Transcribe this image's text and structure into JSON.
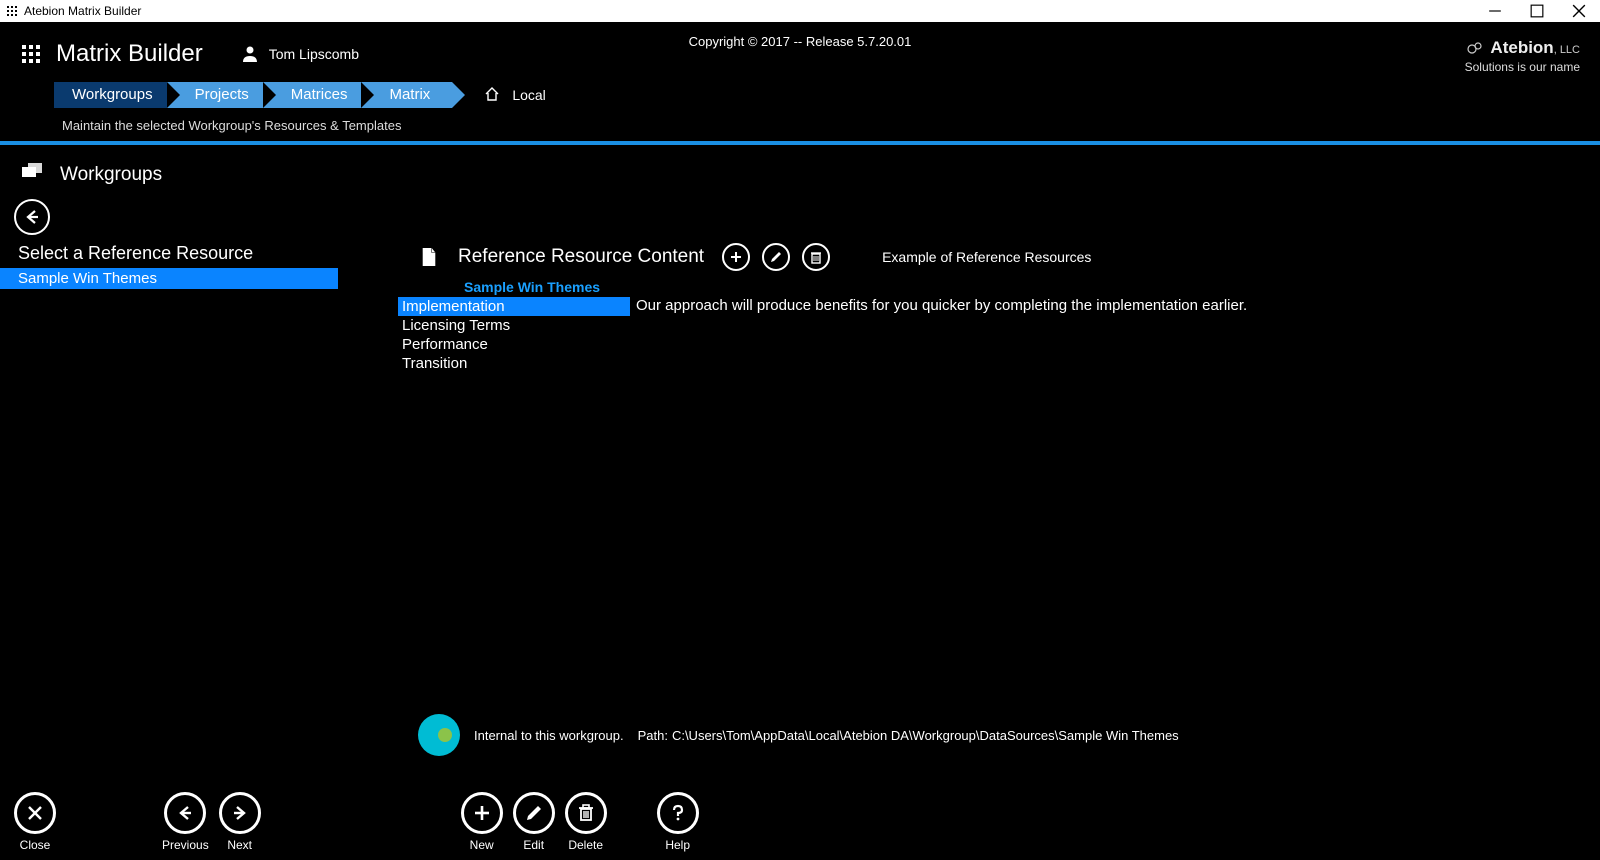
{
  "window": {
    "title": "Atebion Matrix Builder"
  },
  "header": {
    "app_title": "Matrix Builder",
    "user_name": "Tom Lipscomb",
    "copyright": "Copyright © 2017 -- Release 5.7.20.01",
    "logo_name": "Atebion",
    "logo_suffix": ", LLC",
    "logo_tagline": "Solutions is our name"
  },
  "crumbs": {
    "c0": "Workgroups",
    "c1": "Projects",
    "c2": "Matrices",
    "c3": "Matrix",
    "local": "Local"
  },
  "subhead": "Maintain the selected Workgroup's Resources & Templates",
  "section": {
    "title": "Workgroups"
  },
  "left": {
    "title": "Select a Reference Resource",
    "items": {
      "0": "Sample Win Themes"
    }
  },
  "content": {
    "title": "Reference Resource Content",
    "example": "Example of Reference Resources",
    "subname": "Sample Win Themes",
    "items": {
      "0": "Implementation",
      "1": "Licensing Terms",
      "2": "Performance",
      "3": "Transition"
    },
    "detail": "Our approach will produce benefits for you quicker by completing the implementation earlier."
  },
  "status": {
    "internal": "Internal to this workgroup.",
    "path_label": "Path:",
    "path": "C:\\Users\\Tom\\AppData\\Local\\Atebion DA\\Workgroup\\DataSources\\Sample Win Themes"
  },
  "toolbar": {
    "close": "Close",
    "previous": "Previous",
    "next": "Next",
    "new": "New",
    "edit": "Edit",
    "delete": "Delete",
    "help": "Help"
  }
}
